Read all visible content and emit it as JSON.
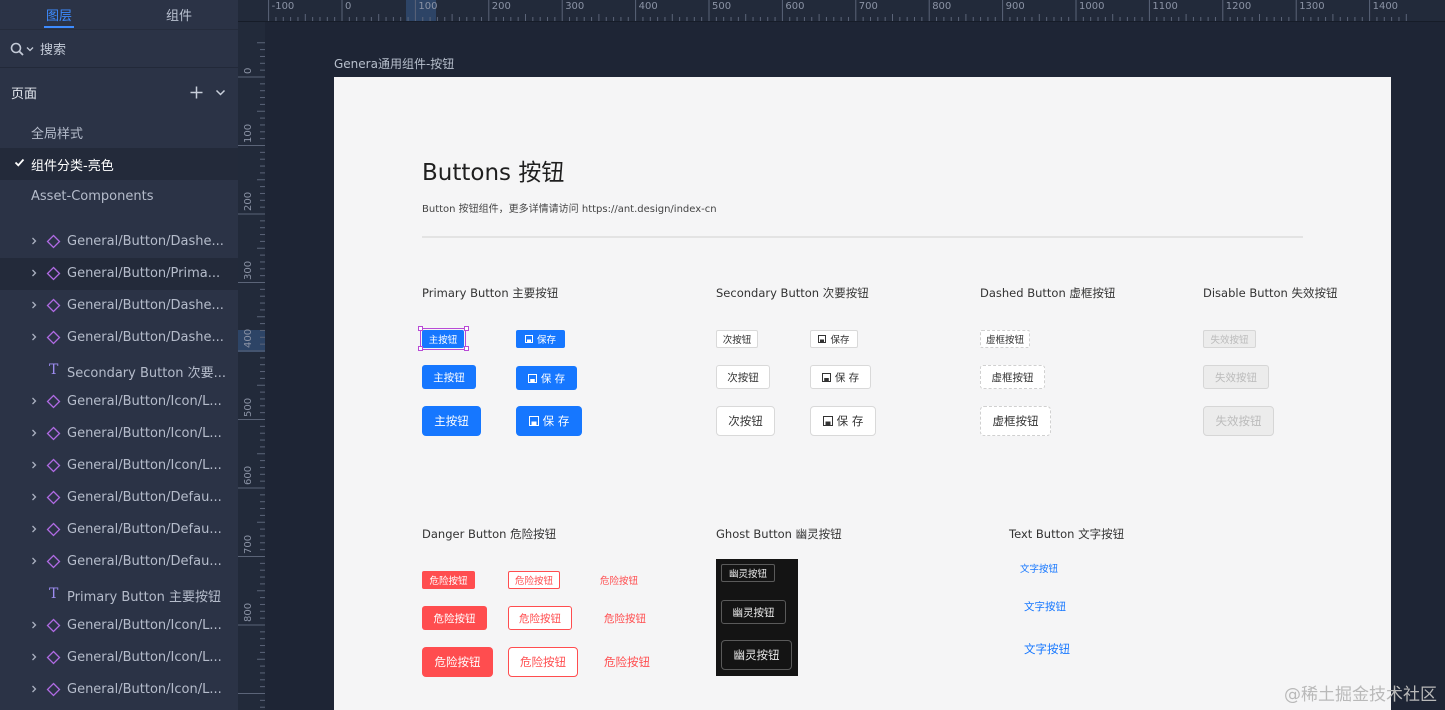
{
  "left_panel": {
    "tabs": [
      "图层",
      "组件"
    ],
    "search_label": "搜索",
    "pages_title": "页面",
    "pages": [
      "全局样式",
      "组件分类-亮色",
      "Asset-Components"
    ],
    "layers": [
      {
        "name": "General/Button/Dashe...",
        "kind": "component"
      },
      {
        "name": "General/Button/Prima...",
        "kind": "component"
      },
      {
        "name": "General/Button/Dashe...",
        "kind": "component"
      },
      {
        "name": "General/Button/Dashe...",
        "kind": "component"
      },
      {
        "name": "Secondary Button 次要...",
        "kind": "text"
      },
      {
        "name": "General/Button/Icon/L...",
        "kind": "component"
      },
      {
        "name": "General/Button/Icon/L...",
        "kind": "component"
      },
      {
        "name": "General/Button/Icon/L...",
        "kind": "component"
      },
      {
        "name": "General/Button/Defau...",
        "kind": "component"
      },
      {
        "name": "General/Button/Defau...",
        "kind": "component"
      },
      {
        "name": "General/Button/Defau...",
        "kind": "component"
      },
      {
        "name": "Primary Button 主要按钮",
        "kind": "text"
      },
      {
        "name": "General/Button/Icon/L...",
        "kind": "component"
      },
      {
        "name": "General/Button/Icon/L...",
        "kind": "component"
      },
      {
        "name": "General/Button/Icon/L...",
        "kind": "component"
      }
    ]
  },
  "rulers": {
    "top": [
      "-100",
      "0",
      "100",
      "200",
      "300",
      "400",
      "500",
      "600",
      "700",
      "800",
      "900",
      "1000",
      "1100",
      "1200",
      "1300",
      "1400"
    ],
    "left": [
      "0",
      "100",
      "200",
      "300",
      "400",
      "500",
      "600",
      "700",
      "800"
    ]
  },
  "canvas": {
    "frame_title": "Genera通用组件-按钮",
    "heading": "Buttons 按钮",
    "description": "Button 按钮组件，更多详情请访问 https://ant.design/index-cn",
    "sections": {
      "primary": {
        "title": "Primary Button 主要按钮",
        "label": "主按钮",
        "save": "保存",
        "save_spaced": "保 存"
      },
      "secondary": {
        "title": "Secondary Button 次要按钮",
        "label": "次按钮",
        "save": "保存",
        "save_spaced": "保 存"
      },
      "dashed": {
        "title": "Dashed Button 虚框按钮",
        "label": "虚框按钮"
      },
      "disabled": {
        "title": "Disable Button 失效按钮",
        "label": "失效按钮"
      },
      "danger": {
        "title": "Danger Button 危险按钮",
        "label": "危险按钮"
      },
      "ghost": {
        "title": "Ghost Button 幽灵按钮",
        "label": "幽灵按钮"
      },
      "text": {
        "title": "Text Button 文字按钮",
        "label": "文字按钮"
      }
    },
    "watermark": "@稀土掘金技术社区"
  },
  "colors": {
    "primary": "#1677ff",
    "danger": "#ff4d4f",
    "selection": "#b84ad6",
    "panel_bg": "#2b3346",
    "canvas_bg": "#1e2535"
  }
}
